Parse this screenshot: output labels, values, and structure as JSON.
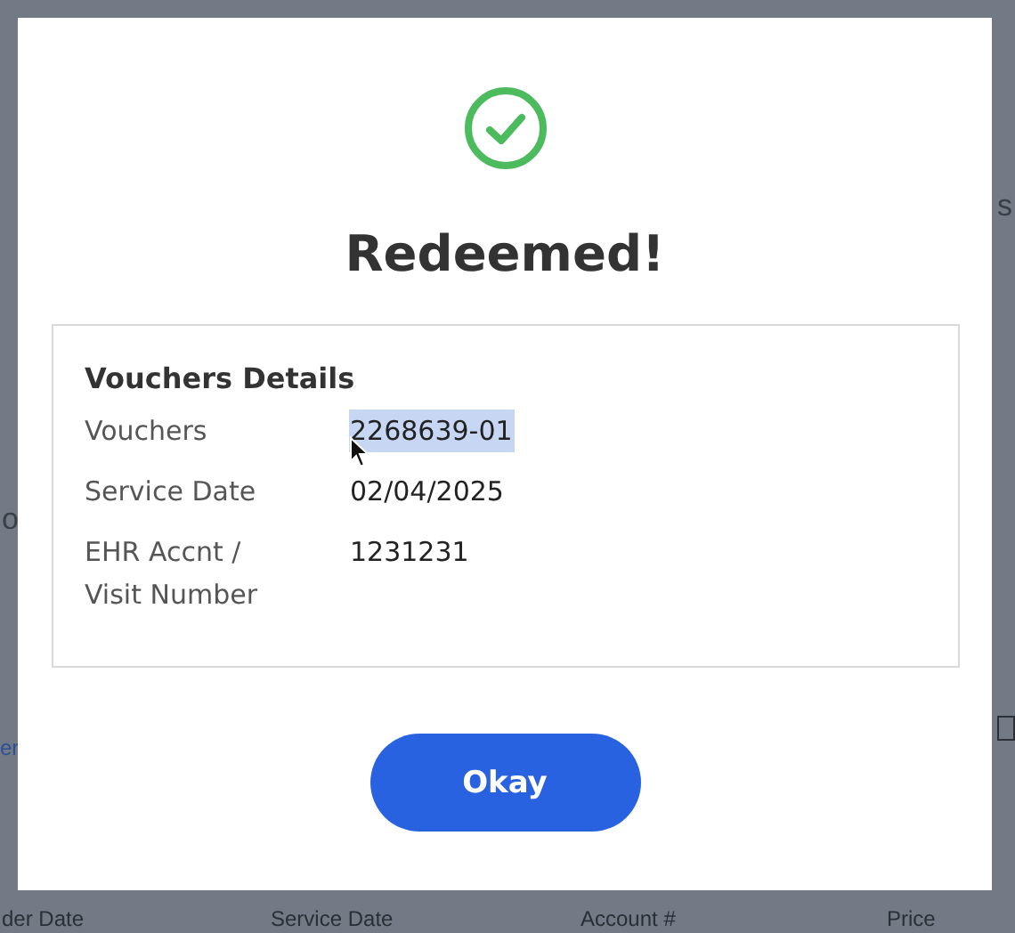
{
  "background": {
    "fragments": [
      {
        "text": "s",
        "kind": "right"
      },
      {
        "text": "o",
        "kind": "left"
      },
      {
        "text": "er",
        "kind": "link"
      }
    ],
    "table_columns": [
      "der Date",
      "Service Date",
      "Account #",
      "Price"
    ]
  },
  "dialog": {
    "title": "Redeemed!",
    "details": {
      "heading": "Vouchers Details",
      "rows": [
        {
          "label": "Vouchers",
          "value": "2268639-01",
          "selected": true
        },
        {
          "label": "Service Date",
          "value": "02/04/2025",
          "selected": false
        },
        {
          "label": "EHR Accnt / Visit Number",
          "value": "1231231",
          "selected": false
        }
      ]
    },
    "button": "Okay"
  }
}
